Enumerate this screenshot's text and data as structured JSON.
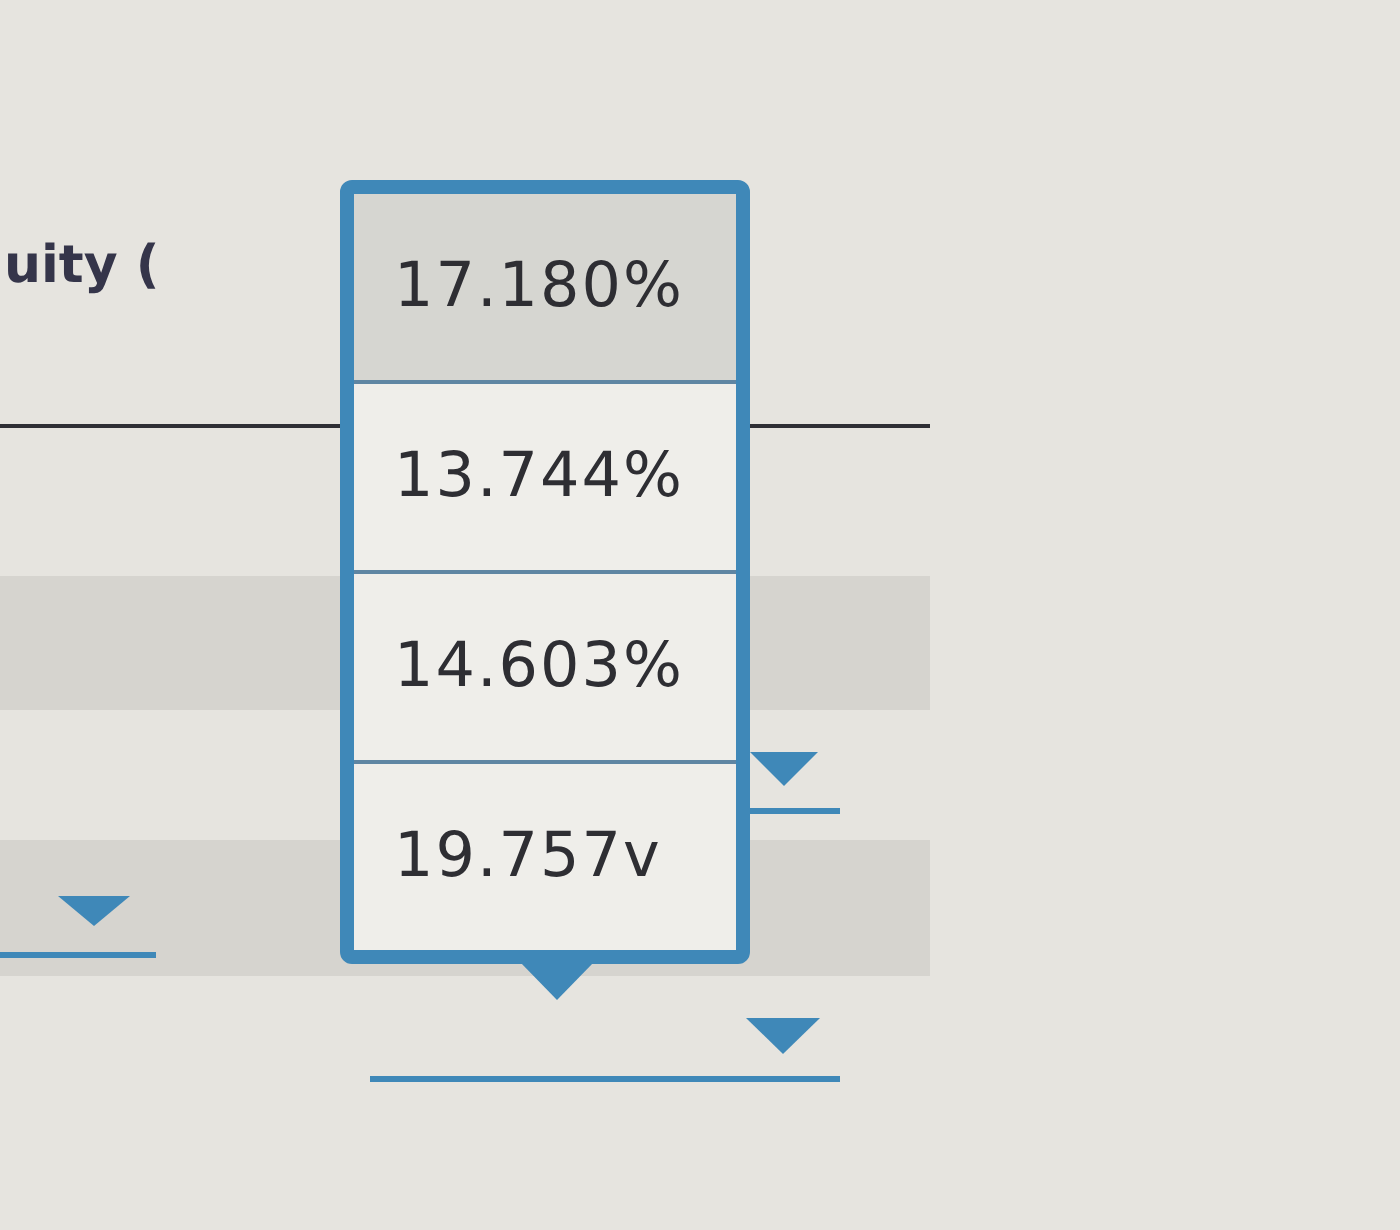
{
  "column_header": "uity (",
  "dropdown": {
    "options": [
      {
        "label": "17.180%",
        "selected": true
      },
      {
        "label": "13.744%",
        "selected": false
      },
      {
        "label": "14.603%",
        "selected": false
      },
      {
        "label": "19.757v",
        "selected": false
      }
    ]
  }
}
